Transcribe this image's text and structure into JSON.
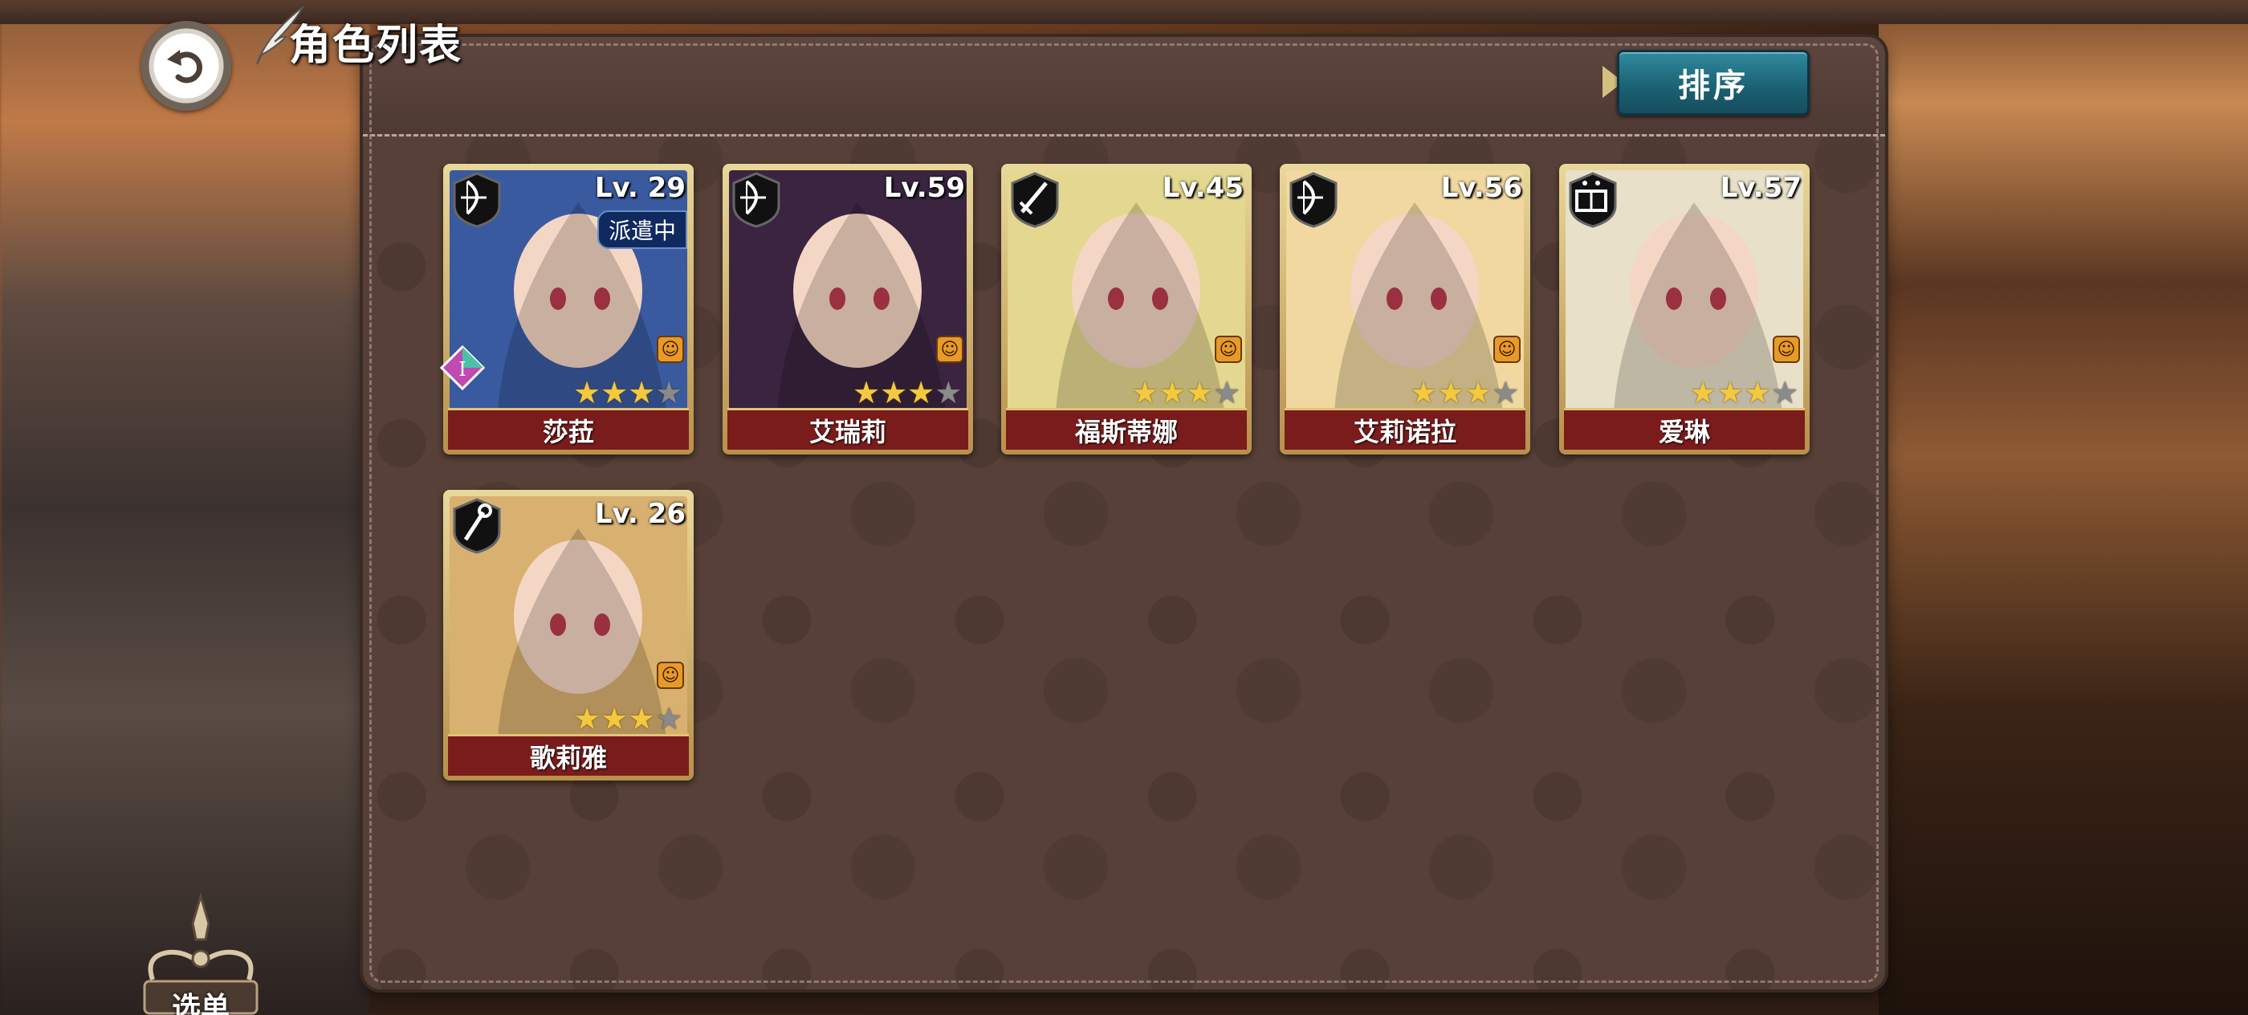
{
  "header": {
    "title": "角色列表",
    "sort_label": "排序"
  },
  "characters": [
    {
      "name": "莎菈",
      "level": "Lv. 29",
      "class": "bow",
      "stars": 3,
      "max_stars": 4,
      "status": "派遣中",
      "bg": "#3a5aa0"
    },
    {
      "name": "艾瑞莉",
      "level": "Lv.59",
      "class": "bow",
      "stars": 3,
      "max_stars": 4,
      "status": "",
      "bg": "#3a2440"
    },
    {
      "name": "福斯蒂娜",
      "level": "Lv.45",
      "class": "sword",
      "stars": 3,
      "max_stars": 4,
      "status": "",
      "bg": "#e4d890"
    },
    {
      "name": "艾莉诺拉",
      "level": "Lv.56",
      "class": "bow",
      "stars": 3,
      "max_stars": 4,
      "status": "",
      "bg": "#f0d8a0"
    },
    {
      "name": "爱琳",
      "level": "Lv.57",
      "class": "book",
      "stars": 3,
      "max_stars": 4,
      "status": "",
      "bg": "#e8e0c8"
    },
    {
      "name": "歌莉雅",
      "level": "Lv. 26",
      "class": "staff",
      "stars": 3,
      "max_stars": 4,
      "status": "",
      "bg": "#d8b070"
    }
  ],
  "menu": {
    "label": "选单"
  },
  "icons": {
    "back": "back-arrow-icon",
    "mood": "smile-icon"
  }
}
